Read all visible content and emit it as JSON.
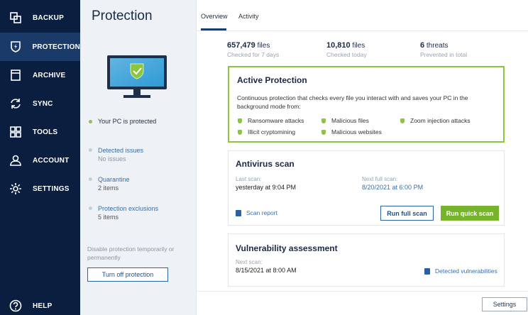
{
  "sidebar": {
    "items": [
      {
        "label": "BACKUP",
        "icon": "backup-icon"
      },
      {
        "label": "PROTECTION",
        "icon": "shield-icon"
      },
      {
        "label": "ARCHIVE",
        "icon": "archive-icon"
      },
      {
        "label": "SYNC",
        "icon": "sync-icon"
      },
      {
        "label": "TOOLS",
        "icon": "tools-icon"
      },
      {
        "label": "ACCOUNT",
        "icon": "account-icon"
      },
      {
        "label": "SETTINGS",
        "icon": "gear-icon"
      }
    ],
    "help": {
      "label": "HELP",
      "icon": "help-icon"
    }
  },
  "subpanel": {
    "title": "Protection",
    "status": "Your PC is protected",
    "detected": {
      "title": "Detected issues",
      "value": "No issues"
    },
    "quarantine": {
      "title": "Quarantine",
      "value": "2 items"
    },
    "exclusions": {
      "title": "Protection exclusions",
      "value": "5 items"
    },
    "disable_text": "Disable protection temporarily or permanently",
    "turn_off_label": "Turn off protection"
  },
  "tabs": {
    "overview": "Overview",
    "activity": "Activity"
  },
  "stats": [
    {
      "number": "657,479",
      "unit": " files",
      "caption": "Checked for 7 days"
    },
    {
      "number": "10,810",
      "unit": " files",
      "caption": "Checked today"
    },
    {
      "number": "6",
      "unit": " threats",
      "caption": "Prevented in total"
    }
  ],
  "active_protection": {
    "title": "Active Protection",
    "description": "Continuous protection that checks every file you interact with and saves your PC in the background mode from:",
    "items": [
      "Ransomware attacks",
      "Malicious files",
      "Zoom injection attacks",
      "Illicit cryptomining",
      "Malicious websites"
    ]
  },
  "antivirus": {
    "title": "Antivirus scan",
    "last_label": "Last scan:",
    "last_value": "yesterday at 9:04 PM",
    "next_label": "Next full scan:",
    "next_value": "8/20/2021 at 6:00 PM",
    "report_link": "Scan report",
    "full_scan_label": "Run full scan",
    "quick_scan_label": "Run quick scan"
  },
  "vulnerability": {
    "title": "Vulnerability assessment",
    "next_label": "Next scan:",
    "next_value": "8/15/2021 at 8:00 AM",
    "link": "Detected vulnerabilities"
  },
  "footer": {
    "settings_label": "Settings"
  },
  "colors": {
    "sidebar": "#0a1f3f",
    "accent_green": "#8cc63f",
    "link_blue": "#3a6ea5"
  }
}
